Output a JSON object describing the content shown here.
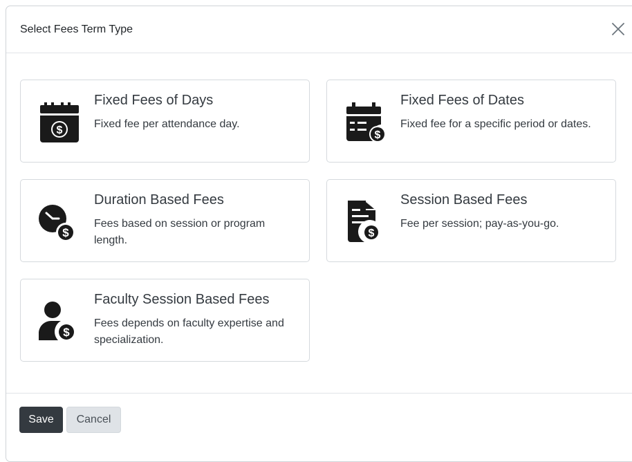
{
  "modal": {
    "title": "Select Fees Term Type",
    "close_icon": "close-icon"
  },
  "options": [
    {
      "title": "Fixed Fees of Days",
      "description": "Fixed fee per attendance day.",
      "icon": "calendar-dollar-icon"
    },
    {
      "title": "Fixed Fees of Dates",
      "description": "Fixed fee for a specific period or dates.",
      "icon": "calendar-list-dollar-icon"
    },
    {
      "title": "Duration Based Fees",
      "description": "Fees based on session or program length.",
      "icon": "clock-dollar-icon"
    },
    {
      "title": "Session Based Fees",
      "description": "Fee per session; pay-as-you-go.",
      "icon": "document-dollar-icon"
    },
    {
      "title": "Faculty Session Based Fees",
      "description": "Fees depends on faculty expertise and specialization.",
      "icon": "user-dollar-icon"
    }
  ],
  "footer": {
    "save_label": "Save",
    "cancel_label": "Cancel"
  },
  "colors": {
    "icon": "#1a1a1a",
    "primary_button": "#343a40",
    "secondary_button": "#dfe3e7"
  }
}
